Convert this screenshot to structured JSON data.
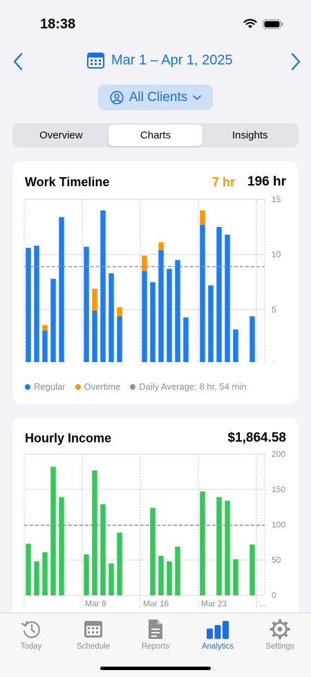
{
  "status": {
    "time": "18:38"
  },
  "header": {
    "date_range": "Mar 1 – Apr 1, 2025",
    "client_filter": "All Clients"
  },
  "segments": [
    "Overview",
    "Charts",
    "Insights"
  ],
  "colors": {
    "accent": "#1a6fe8",
    "regular": "#1c7cf2",
    "overtime": "#ff9500",
    "income": "#34c759",
    "average": "#8e8e93"
  },
  "work_card": {
    "title": "Work Timeline",
    "overtime_total": "7 hr",
    "total": "196 hr",
    "legend": {
      "regular": "Regular",
      "overtime": "Overtime",
      "average": "Daily Average: 8 hr, 54 min"
    }
  },
  "income_card": {
    "title": "Hourly Income",
    "total": "$1,864.58"
  },
  "chart_data": [
    {
      "type": "bar",
      "title": "Work Timeline",
      "x_tick_labels": [
        "Mar 9",
        "Mar 16",
        "Mar 23",
        "..."
      ],
      "ylim": [
        0,
        15
      ],
      "y_ticks": [
        "0",
        "5",
        "10",
        "15"
      ],
      "average": 8.9,
      "grid": true,
      "legend_position": "bottom",
      "series": [
        {
          "name": "Regular",
          "values": [
            10.6,
            10.8,
            3.1,
            7.8,
            13.4,
            0,
            0,
            10.7,
            4.9,
            14.0,
            8.3,
            4.4,
            0,
            0,
            8.5,
            7.5,
            10.4,
            8.7,
            9.5,
            4.3,
            0,
            12.7,
            7.2,
            12.5,
            11.8,
            3.2,
            0,
            4.4
          ]
        },
        {
          "name": "Overtime",
          "values": [
            0,
            0,
            0.5,
            0,
            0,
            0,
            0,
            0,
            2.0,
            0,
            0,
            0.8,
            0,
            0,
            1.4,
            0,
            0.7,
            0,
            0,
            0,
            0,
            1.3,
            0,
            0,
            0,
            0,
            0,
            0
          ]
        }
      ]
    },
    {
      "type": "bar",
      "title": "Hourly Income",
      "x_tick_labels": [
        "Mar 9",
        "Mar 16",
        "Mar 23",
        "..."
      ],
      "ylim": [
        0,
        200
      ],
      "y_ticks": [
        "0",
        "50",
        "100",
        "150",
        "200"
      ],
      "average": 99,
      "grid": true,
      "series": [
        {
          "name": "Hourly Income",
          "values": [
            73,
            48,
            61,
            182,
            139,
            0,
            0,
            58,
            177,
            129,
            45,
            89,
            0,
            0,
            0,
            124,
            56,
            48,
            69,
            0,
            0,
            147,
            0,
            139,
            134,
            51,
            0,
            72
          ]
        }
      ]
    }
  ],
  "tabbar": [
    {
      "label": "Today",
      "icon": "clock-arrow-icon"
    },
    {
      "label": "Schedule",
      "icon": "calendar-icon"
    },
    {
      "label": "Reports",
      "icon": "document-icon"
    },
    {
      "label": "Analytics",
      "icon": "bar-chart-icon",
      "active": true
    },
    {
      "label": "Settings",
      "icon": "gear-icon"
    }
  ]
}
